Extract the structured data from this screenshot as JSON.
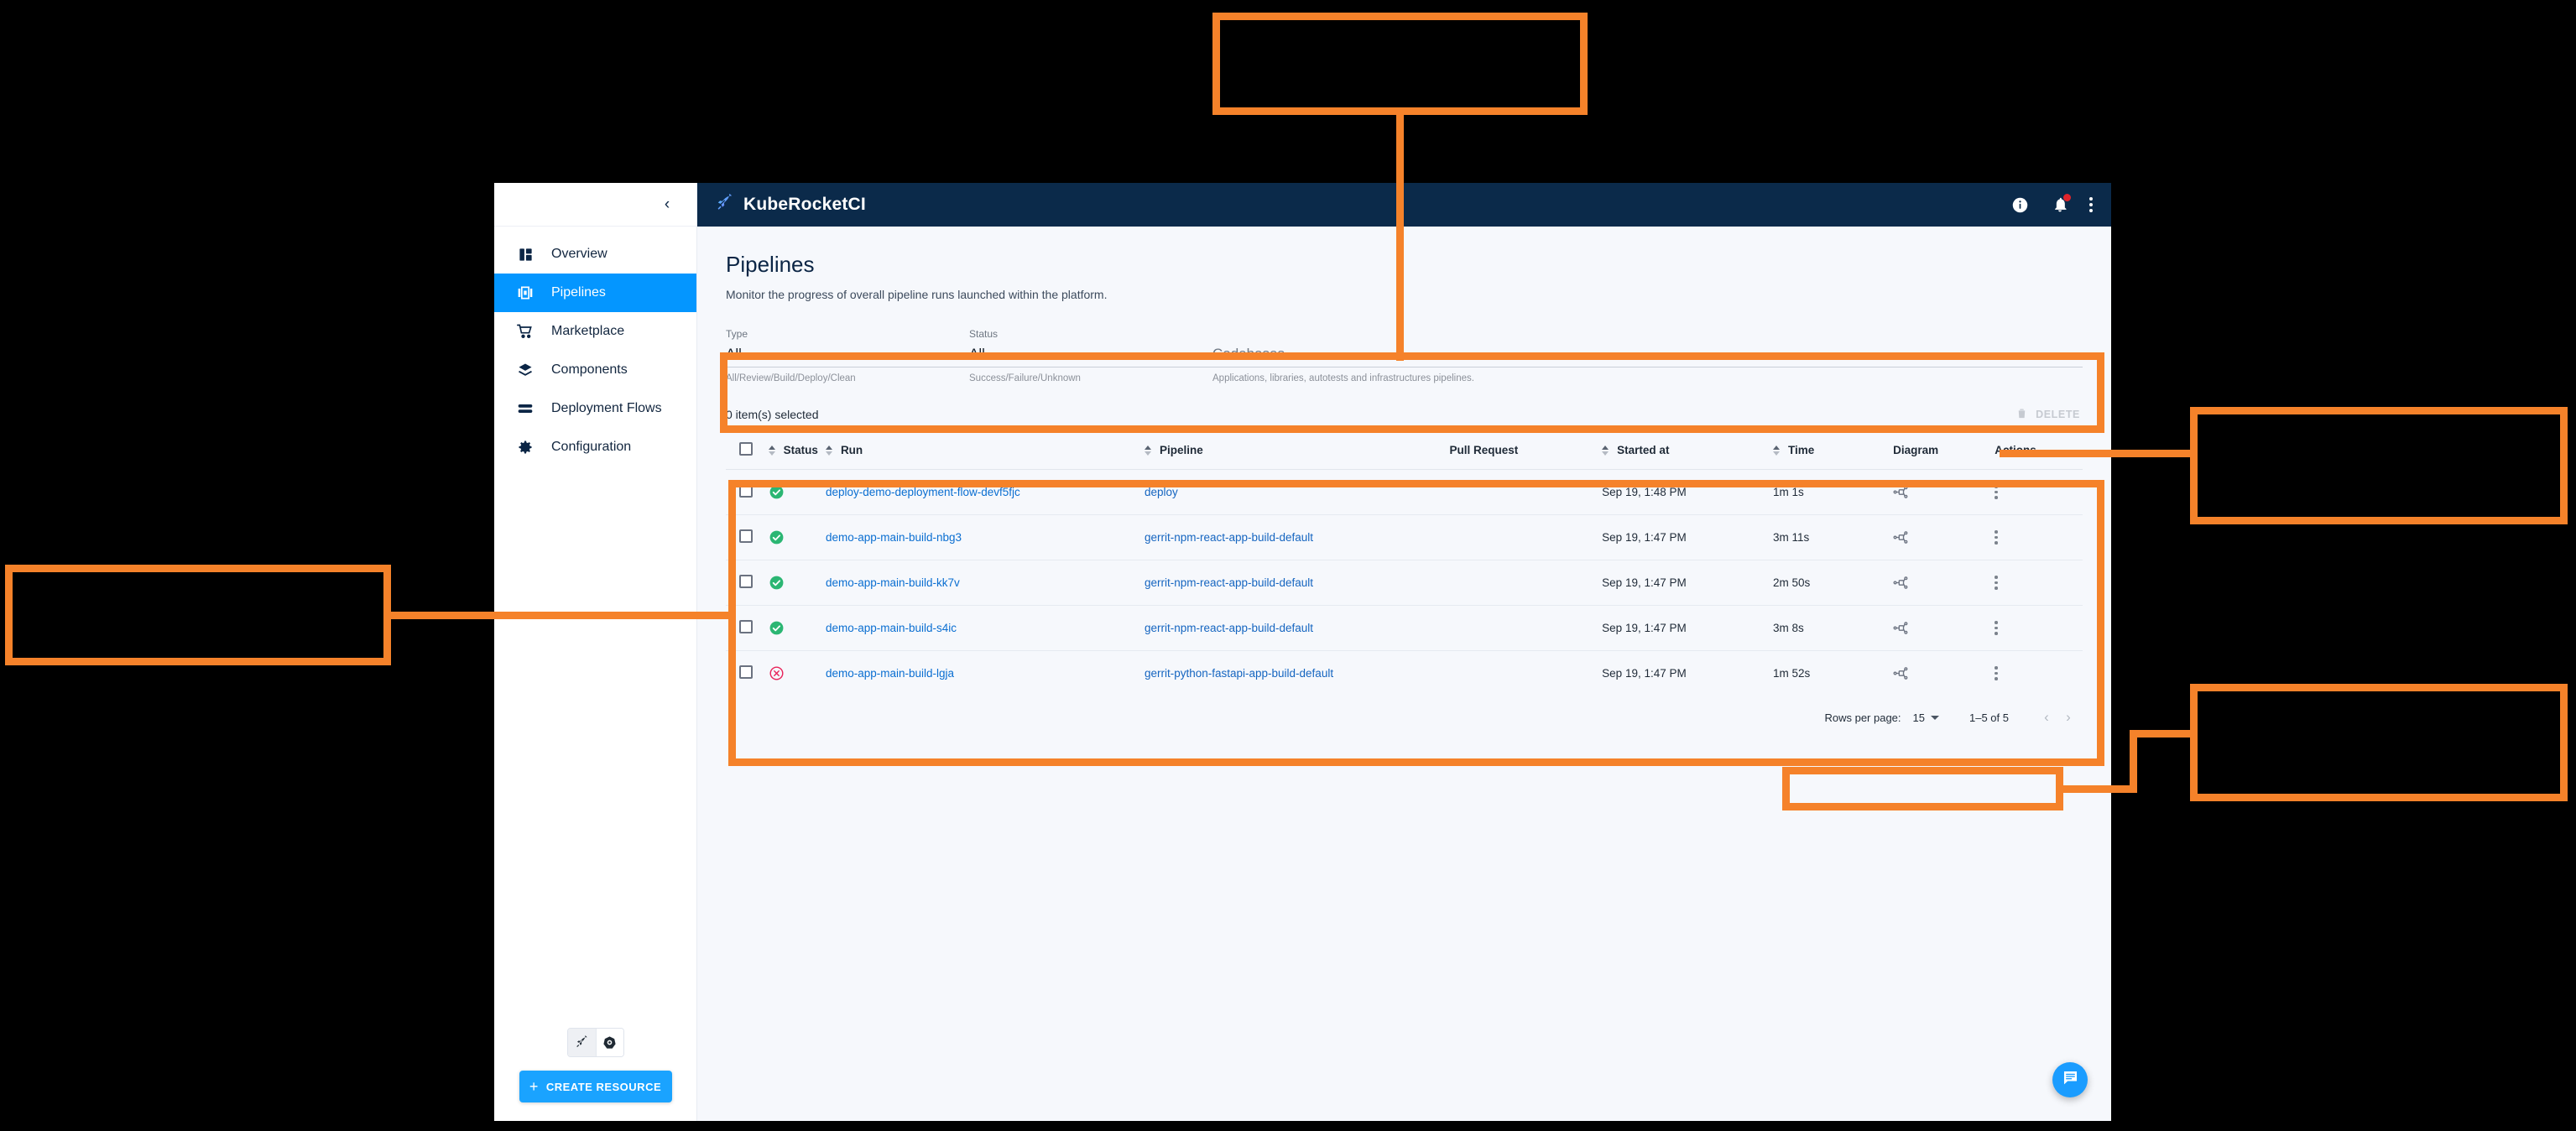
{
  "app": {
    "brand_title": "KubeRocketCI",
    "brand_icon": "rocket-pen-icon",
    "collapse_icon": "chevron-left-icon",
    "topbar_icons": [
      "info-icon",
      "bell-icon",
      "kebab-menu-icon"
    ]
  },
  "sidebar": {
    "items": [
      {
        "label": "Overview",
        "icon": "dashboard-icon",
        "active": false
      },
      {
        "label": "Pipelines",
        "icon": "pipelines-icon",
        "active": true
      },
      {
        "label": "Marketplace",
        "icon": "cart-icon",
        "active": false
      },
      {
        "label": "Components",
        "icon": "layers-icon",
        "active": false
      },
      {
        "label": "Deployment Flows",
        "icon": "flows-icon",
        "active": false
      },
      {
        "label": "Configuration",
        "icon": "gear-icon",
        "active": false
      }
    ],
    "mode_toggle": [
      {
        "icon": "krci-pen-icon",
        "selected": true
      },
      {
        "icon": "kubernetes-icon",
        "selected": false
      }
    ],
    "create_button": "CREATE RESOURCE"
  },
  "page": {
    "title": "Pipelines",
    "subtitle": "Monitor the progress of overall pipeline runs launched within the platform."
  },
  "filters": {
    "type": {
      "label": "Type",
      "value": "All",
      "hint": "All/Review/Build/Deploy/Clean"
    },
    "status": {
      "label": "Status",
      "value": "All",
      "hint": "Success/Failure/Unknown"
    },
    "codebases": {
      "placeholder": "Codebases",
      "hint": "Applications, libraries, autotests and infrastructures pipelines."
    }
  },
  "toolbar": {
    "selected_text": "0 item(s) selected",
    "delete_label": "DELETE",
    "delete_icon": "trash-icon"
  },
  "table": {
    "columns": [
      {
        "key": "checkbox",
        "label": "",
        "sortable": false
      },
      {
        "key": "status",
        "label": "Status",
        "sortable": true
      },
      {
        "key": "run",
        "label": "Run",
        "sortable": true
      },
      {
        "key": "pipeline",
        "label": "Pipeline",
        "sortable": true
      },
      {
        "key": "pull_request",
        "label": "Pull Request",
        "sortable": false
      },
      {
        "key": "started_at",
        "label": "Started at",
        "sortable": true
      },
      {
        "key": "time",
        "label": "Time",
        "sortable": true
      },
      {
        "key": "diagram",
        "label": "Diagram",
        "sortable": false
      },
      {
        "key": "actions",
        "label": "Actions",
        "sortable": false
      }
    ],
    "rows": [
      {
        "status": "success",
        "status_icon": "check-circle-icon",
        "run": "deploy-demo-deployment-flow-devf5fjc",
        "pipeline": "deploy",
        "pull_request": "",
        "started_at": "Sep 19, 1:48 PM",
        "time": "1m 1s",
        "diagram_icon": "diagram-icon",
        "actions_icon": "kebab-menu-icon"
      },
      {
        "status": "success",
        "status_icon": "check-circle-icon",
        "run": "demo-app-main-build-nbg3",
        "pipeline": "gerrit-npm-react-app-build-default",
        "pull_request": "",
        "started_at": "Sep 19, 1:47 PM",
        "time": "3m 11s",
        "diagram_icon": "diagram-icon",
        "actions_icon": "kebab-menu-icon"
      },
      {
        "status": "success",
        "status_icon": "check-circle-icon",
        "run": "demo-app-main-build-kk7v",
        "pipeline": "gerrit-npm-react-app-build-default",
        "pull_request": "",
        "started_at": "Sep 19, 1:47 PM",
        "time": "2m 50s",
        "diagram_icon": "diagram-icon",
        "actions_icon": "kebab-menu-icon"
      },
      {
        "status": "success",
        "status_icon": "check-circle-icon",
        "run": "demo-app-main-build-s4ic",
        "pipeline": "gerrit-npm-react-app-build-default",
        "pull_request": "",
        "started_at": "Sep 19, 1:47 PM",
        "time": "3m 8s",
        "diagram_icon": "diagram-icon",
        "actions_icon": "kebab-menu-icon"
      },
      {
        "status": "failed",
        "status_icon": "x-circle-icon",
        "run": "demo-app-main-build-lgja",
        "pipeline": "gerrit-python-fastapi-app-build-default",
        "pull_request": "",
        "started_at": "Sep 19, 1:47 PM",
        "time": "1m 52s",
        "diagram_icon": "diagram-icon",
        "actions_icon": "kebab-menu-icon"
      }
    ]
  },
  "pagination": {
    "rows_per_page_label": "Rows per page:",
    "rows_per_page_value": "15",
    "range": "1–5 of 5",
    "prev_icon": "chevron-left-icon",
    "next_icon": "chevron-right-icon"
  },
  "fab": {
    "icon": "chat-icon"
  },
  "colors": {
    "accent_blue": "#0496ff",
    "topbar_navy": "#0b2a4a",
    "annotation_orange": "#f5822a",
    "success_green": "#2bb673",
    "error_red": "#e8235a",
    "link_blue": "#0a6ed1"
  },
  "annotations": [
    {
      "name": "callout-topbar",
      "target": "topbar"
    },
    {
      "name": "callout-filters",
      "target": "filters"
    },
    {
      "name": "callout-delete",
      "target": "delete-button"
    },
    {
      "name": "callout-table",
      "target": "table"
    },
    {
      "name": "callout-pagination",
      "target": "pagination"
    }
  ]
}
